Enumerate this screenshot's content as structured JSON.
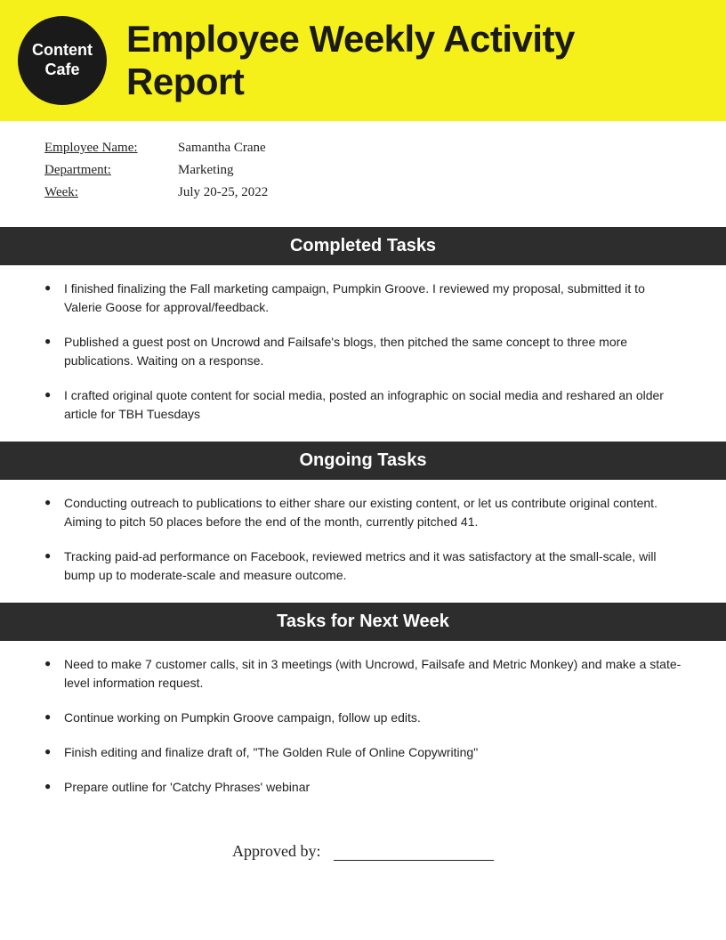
{
  "header": {
    "logo_line1": "Content",
    "logo_line2": "Cafe",
    "title": "Employee Weekly Activity Report"
  },
  "employee_info": {
    "name_label": "Employee Name:",
    "name_value": "Samantha Crane",
    "department_label": "Department:",
    "department_value": "Marketing",
    "week_label": "Week:",
    "week_value": "July 20-25, 2022"
  },
  "sections": {
    "completed": {
      "heading": "Completed Tasks",
      "tasks": [
        "I finished finalizing the Fall marketing campaign, Pumpkin Groove. I reviewed my proposal, submitted it to Valerie Goose for approval/feedback.",
        "Published a guest post on Uncrowd and Failsafe's blogs, then pitched the same concept to three more publications. Waiting on a response.",
        "I crafted original quote content for social media, posted an infographic on social media and reshared an older article for TBH Tuesdays"
      ]
    },
    "ongoing": {
      "heading": "Ongoing Tasks",
      "tasks": [
        "Conducting outreach to publications to either share our existing content, or let us contribute original content. Aiming to pitch 50 places before the end of the month, currently pitched 41.",
        "Tracking paid-ad performance on Facebook, reviewed metrics and it was satisfactory at the small-scale, will bump up to moderate-scale and measure outcome."
      ]
    },
    "next_week": {
      "heading": "Tasks for Next Week",
      "tasks": [
        "Need to make 7 customer calls, sit in 3 meetings (with Uncrowd, Failsafe and Metric Monkey) and make a state-level information request.",
        "Continue working on Pumpkin Groove campaign, follow up edits.",
        "Finish editing and finalize draft of, \"The Golden Rule of Online Copywriting\"",
        "Prepare outline for 'Catchy Phrases' webinar"
      ]
    }
  },
  "footer": {
    "approved_label": "Approved by:"
  }
}
